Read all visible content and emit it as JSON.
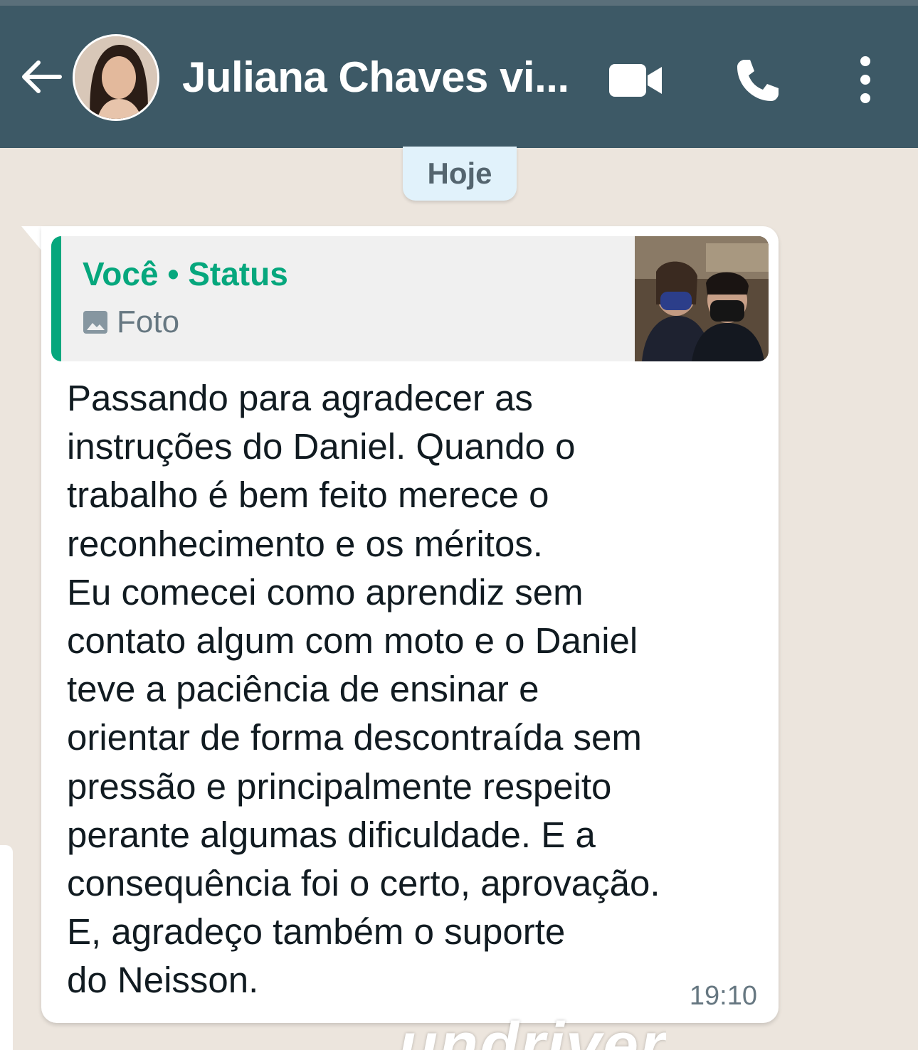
{
  "header": {
    "contact_name": "Juliana Chaves vi...",
    "back_icon": "arrow-left-icon",
    "video_icon": "video-camera-icon",
    "call_icon": "phone-icon",
    "menu_icon": "more-vertical-icon",
    "background_color": "#3d5966"
  },
  "chat": {
    "date_label": "Hoje",
    "message": {
      "quote": {
        "author": "Você • Status",
        "type_label": "Foto",
        "type_icon": "photo-icon",
        "accent_color": "#06a77d"
      },
      "text": "Passando para agradecer as\ninstruções do Daniel. Quando o\ntrabalho é bem feito merece o\nreconhecimento e os méritos.\nEu comecei como aprendiz sem\ncontato algum com moto e o Daniel\nteve a paciência de ensinar e\norientar de forma descontraída sem\npressão e principalmente respeito\nperante algumas dificuldade. E a\nconsequência foi o certo, aprovação.\nE, agradeço também o suporte\ndo Neisson.",
      "time": "19:10"
    }
  },
  "watermark": "undriver"
}
